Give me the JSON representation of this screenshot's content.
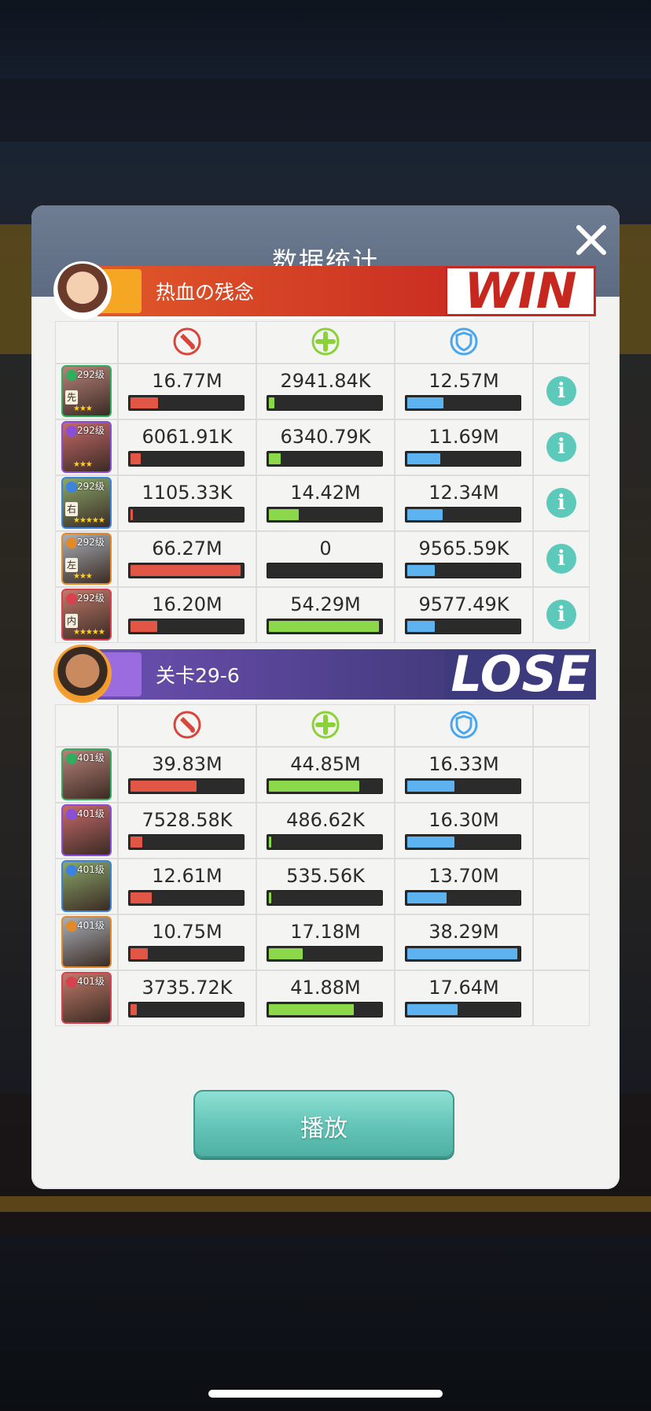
{
  "panel": {
    "title": "数据统计",
    "play_label": "播放"
  },
  "icons": {
    "damage": "sword-slash-icon",
    "heal": "plus-cross-icon",
    "defense": "shield-icon",
    "info": "i"
  },
  "colors": {
    "damage": "#e25646",
    "heal": "#8bd84a",
    "defense": "#5cb3f0",
    "win_band": "#cf2f22",
    "lose_band": "#4a3f82"
  },
  "teams": [
    {
      "name": "热血の残念",
      "result": "WIN",
      "heroes": [
        {
          "level": "292级",
          "position": "先",
          "stars": 3,
          "damage": "16.77M",
          "damage_pct": 0.25,
          "heal": "2941.84K",
          "heal_pct": 0.05,
          "defense": "12.57M",
          "defense_pct": 0.33
        },
        {
          "level": "292级",
          "position": "",
          "stars": 3,
          "damage": "6061.91K",
          "damage_pct": 0.09,
          "heal": "6340.79K",
          "heal_pct": 0.11,
          "defense": "11.69M",
          "defense_pct": 0.3
        },
        {
          "level": "292级",
          "position": "右",
          "stars": 5,
          "damage": "1105.33K",
          "damage_pct": 0.02,
          "heal": "14.42M",
          "heal_pct": 0.27,
          "defense": "12.34M",
          "defense_pct": 0.32
        },
        {
          "level": "292级",
          "position": "左",
          "stars": 3,
          "damage": "66.27M",
          "damage_pct": 1.0,
          "heal": "0",
          "heal_pct": 0.0,
          "defense": "9565.59K",
          "defense_pct": 0.25
        },
        {
          "level": "292级",
          "position": "内",
          "stars": 5,
          "damage": "16.20M",
          "damage_pct": 0.24,
          "heal": "54.29M",
          "heal_pct": 1.0,
          "defense": "9577.49K",
          "defense_pct": 0.25
        }
      ]
    },
    {
      "name": "关卡29-6",
      "result": "LOSE",
      "heroes": [
        {
          "level": "401级",
          "damage": "39.83M",
          "damage_pct": 0.6,
          "heal": "44.85M",
          "heal_pct": 0.82,
          "defense": "16.33M",
          "defense_pct": 0.43
        },
        {
          "level": "401级",
          "damage": "7528.58K",
          "damage_pct": 0.11,
          "heal": "486.62K",
          "heal_pct": 0.01,
          "defense": "16.30M",
          "defense_pct": 0.43
        },
        {
          "level": "401级",
          "damage": "12.61M",
          "damage_pct": 0.19,
          "heal": "535.56K",
          "heal_pct": 0.01,
          "defense": "13.70M",
          "defense_pct": 0.36
        },
        {
          "level": "401级",
          "damage": "10.75M",
          "damage_pct": 0.16,
          "heal": "17.18M",
          "heal_pct": 0.31,
          "defense": "38.29M",
          "defense_pct": 1.0
        },
        {
          "level": "401级",
          "damage": "3735.72K",
          "damage_pct": 0.06,
          "heal": "41.88M",
          "heal_pct": 0.77,
          "defense": "17.64M",
          "defense_pct": 0.46
        }
      ]
    }
  ]
}
